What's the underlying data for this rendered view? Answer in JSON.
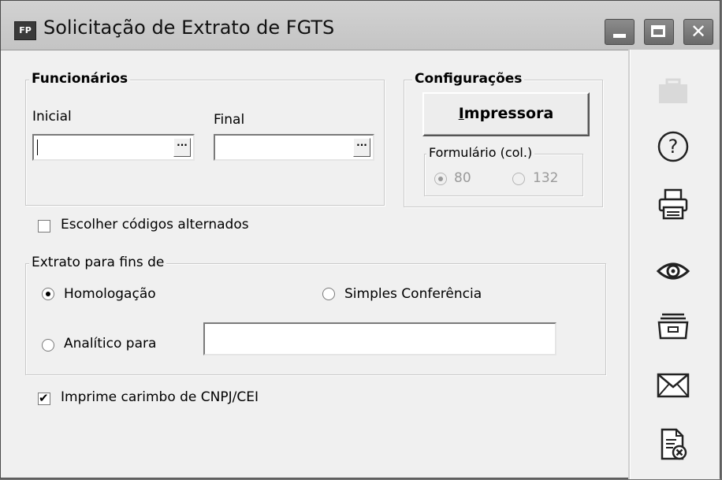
{
  "window": {
    "app_icon_text": "FP",
    "title": "Solicitação de Extrato de FGTS",
    "close_glyph": "✕"
  },
  "funcionarios": {
    "legend": "Funcionários",
    "inicial_label": "Inicial",
    "final_label": "Final",
    "inicial_value": "",
    "final_value": "",
    "lookup_glyph": "···"
  },
  "configuracoes": {
    "legend": "Configurações",
    "impressora_hotkey": "I",
    "impressora_rest": "mpressora",
    "formulario": {
      "legend": "Formulário (col.)",
      "options": [
        {
          "label": "80",
          "selected": true,
          "enabled": false
        },
        {
          "label": "132",
          "selected": false,
          "enabled": false
        }
      ]
    }
  },
  "escolher_codigos": {
    "label": "Escolher códigos alternados",
    "checked": false
  },
  "extrato": {
    "legend": "Extrato para fins de",
    "homologacao": {
      "label": "Homologação",
      "selected": true
    },
    "simples": {
      "label": "Simples Conferência",
      "selected": false
    },
    "analitico": {
      "label": "Analítico para",
      "selected": false
    },
    "analitico_value": ""
  },
  "imprime_carimbo": {
    "label": "Imprime carimbo de CNPJ/CEI",
    "checked": true
  },
  "toolbar": {
    "icons": [
      "briefcase-icon",
      "help-icon",
      "printer-icon",
      "preview-eye-icon",
      "archive-icon",
      "email-icon",
      "cancel-document-icon"
    ],
    "help_glyph": "?"
  },
  "colors": {
    "window_bg": "#f0f0f0",
    "titlebar": "#c8c8c8",
    "caption_buttons": "#7a7a7a"
  }
}
